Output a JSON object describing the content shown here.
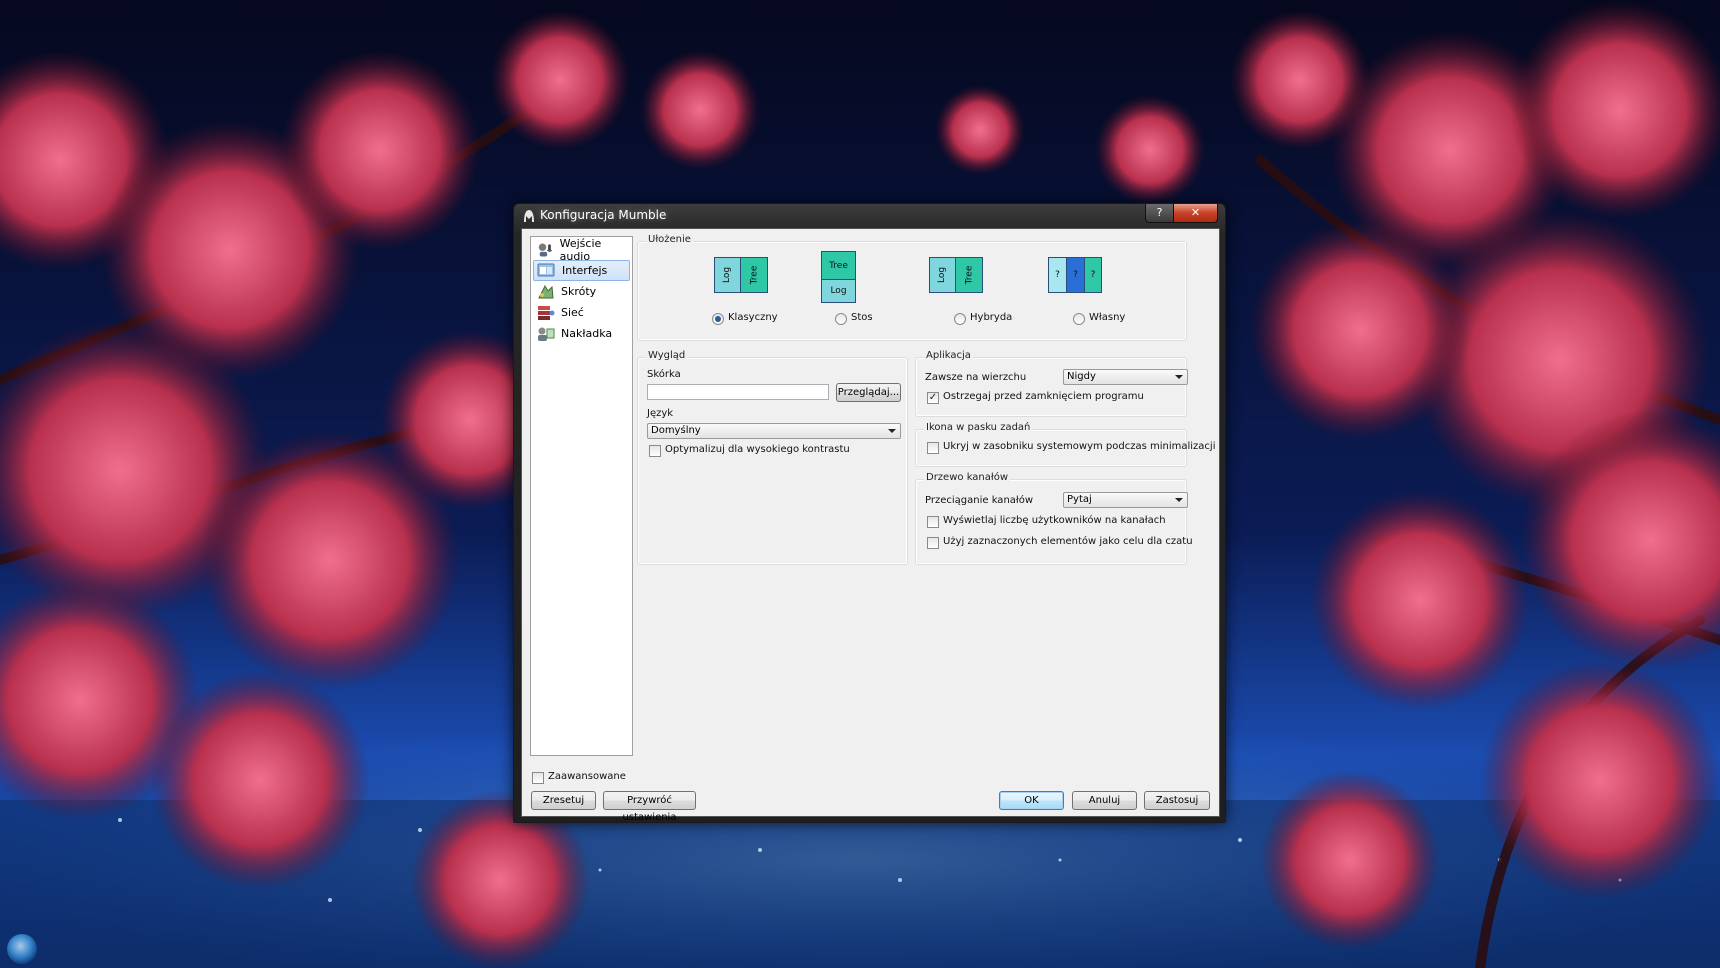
{
  "window": {
    "title": "Konfiguracja Mumble",
    "help_button": "?",
    "close_button": "✕"
  },
  "nav": {
    "items": [
      {
        "label": "Wejście audio",
        "icon": "microphone-icon",
        "selected": false
      },
      {
        "label": "Interfejs",
        "icon": "interface-icon",
        "selected": true
      },
      {
        "label": "Skróty",
        "icon": "shortcuts-icon",
        "selected": false
      },
      {
        "label": "Sieć",
        "icon": "network-icon",
        "selected": false
      },
      {
        "label": "Nakładka",
        "icon": "overlay-icon",
        "selected": false
      }
    ]
  },
  "layout_group": {
    "title": "Ułożenie",
    "options": [
      {
        "label": "Klasyczny",
        "selected": true,
        "panes": [
          "Log",
          "Tree"
        ]
      },
      {
        "label": "Stos",
        "selected": false,
        "panes": [
          "Tree",
          "Log"
        ]
      },
      {
        "label": "Hybryda",
        "selected": false,
        "panes": [
          "Log",
          "Tree"
        ]
      },
      {
        "label": "Własny",
        "selected": false,
        "panes": [
          "?",
          "?",
          "?"
        ]
      }
    ]
  },
  "appearance": {
    "title": "Wygląd",
    "skin_label": "Skórka",
    "skin_value": "",
    "browse_button": "Przeglądaj...",
    "language_label": "Język",
    "language_value": "Domyślny",
    "high_contrast_label": "Optymalizuj dla wysokiego kontrastu",
    "high_contrast_checked": false
  },
  "application": {
    "title": "Aplikacja",
    "always_on_top_label": "Zawsze na wierzchu",
    "always_on_top_value": "Nigdy",
    "warn_on_close_label": "Ostrzegaj przed zamknięciem programu",
    "warn_on_close_checked": true
  },
  "tray": {
    "title": "Ikona w pasku zadań",
    "hide_in_tray_label": "Ukryj w zasobniku systemowym podczas minimalizacji",
    "hide_in_tray_checked": false
  },
  "channel_tree": {
    "title": "Drzewo kanałów",
    "drag_label": "Przeciąganie kanałów",
    "drag_value": "Pytaj",
    "show_user_count_label": "Wyświetlaj liczbę użytkowników na kanałach",
    "show_user_count_checked": false,
    "use_selected_label": "Użyj zaznaczonych elementów jako celu dla czatu",
    "use_selected_checked": false
  },
  "footer": {
    "advanced_label": "Zaawansowane",
    "advanced_checked": false,
    "reset_button": "Zresetuj",
    "restore_button": "Przywróć ustawienia",
    "ok_button": "OK",
    "cancel_button": "Anuluj",
    "apply_button": "Zastosuj"
  },
  "colors": {
    "log_pane": "#7fd6dc",
    "tree_pane": "#2fc8a6",
    "custom_pane_light": "#a8e6f0",
    "custom_pane_blue": "#2a6fd6",
    "selection": "#cfe2f9"
  }
}
